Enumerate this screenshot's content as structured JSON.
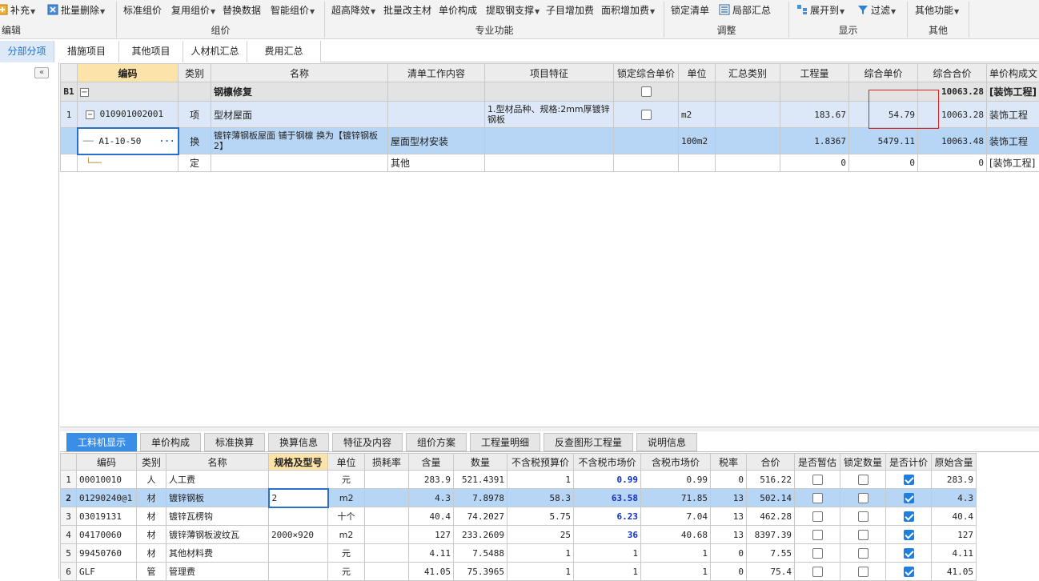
{
  "ribbon": {
    "items": [
      {
        "label": "补充",
        "icon": "add-icon",
        "dropdown": true
      },
      {
        "label": "批量删除",
        "icon": "batch-delete-icon",
        "dropdown": true
      },
      {
        "label": "标准组价",
        "dropdown": false
      },
      {
        "label": "复用组价",
        "dropdown": true
      },
      {
        "label": "替换数据",
        "dropdown": false
      },
      {
        "label": "智能组价",
        "dropdown": true
      },
      {
        "label": "超高降效",
        "dropdown": true
      },
      {
        "label": "批量改主材",
        "dropdown": false
      },
      {
        "label": "单价构成",
        "dropdown": false
      },
      {
        "label": "提取钢支撑",
        "dropdown": true
      },
      {
        "label": "子目增加费",
        "dropdown": false
      },
      {
        "label": "面积增加费",
        "dropdown": true
      },
      {
        "label": "锁定清单",
        "dropdown": false
      },
      {
        "label": "局部汇总",
        "icon": "partial-summary-icon",
        "dropdown": false
      },
      {
        "label": "展开到",
        "icon": "expand-icon",
        "dropdown": true
      },
      {
        "label": "过滤",
        "icon": "filter-icon",
        "dropdown": true
      },
      {
        "label": "其他功能",
        "dropdown": true
      }
    ],
    "groups": [
      "编辑",
      "组价",
      "专业功能",
      "调整",
      "显示",
      "其他"
    ]
  },
  "tabs": [
    "分部分项",
    "措施项目",
    "其他项目",
    "人材机汇总",
    "费用汇总"
  ],
  "top_grid": {
    "headers": [
      "编码",
      "类别",
      "名称",
      "清单工作内容",
      "项目特征",
      "锁定综合单价",
      "单位",
      "汇总类别",
      "工程量",
      "综合单价",
      "综合合价",
      "单价构成文"
    ],
    "row_b1": {
      "num": "B1",
      "name": "钢檩修复",
      "total": "10063.28",
      "composition": "[装饰工程]"
    },
    "row_1": {
      "num": "1",
      "code": "010901002001",
      "type": "项",
      "name": "型材屋面",
      "feature": "1.型材品种、规格:2mm厚镀锌钢板",
      "unit": "m2",
      "qty": "183.67",
      "unit_price": "54.79",
      "total": "10063.28",
      "composition": "装饰工程"
    },
    "row_sub": {
      "code": "A1-10-50",
      "more": "···",
      "type": "换",
      "name": "镀锌薄钢板屋面 铺于钢檩  换为【镀锌钢板2】",
      "work": "屋面型材安装",
      "unit": "100m2",
      "qty": "1.8367",
      "unit_price": "5479.11",
      "total": "10063.48",
      "composition": "装饰工程"
    },
    "row_def": {
      "type": "定",
      "work": "其他",
      "qty": "0",
      "unit_price": "0",
      "total": "0",
      "composition": "[装饰工程]"
    }
  },
  "bottom_tabs": [
    "工料机显示",
    "单价构成",
    "标准换算",
    "换算信息",
    "特征及内容",
    "组价方案",
    "工程量明细",
    "反查图形工程量",
    "说明信息"
  ],
  "bottom_grid": {
    "headers": [
      "编码",
      "类别",
      "名称",
      "规格及型号",
      "单位",
      "损耗率",
      "含量",
      "数量",
      "不含税预算价",
      "不含税市场价",
      "含税市场价",
      "税率",
      "合价",
      "是否暂估",
      "锁定数量",
      "是否计价",
      "原始含量"
    ],
    "rows": [
      {
        "num": "1",
        "code": "00010010",
        "type": "人",
        "name": "人工费",
        "spec": "",
        "unit": "元",
        "loss": "",
        "content": "283.9",
        "qty": "521.4391",
        "pre_budget": "1",
        "pre_market": "0.99",
        "tax_market": "0.99",
        "tax": "0",
        "total": "516.22",
        "est": false,
        "lock": false,
        "priced": true,
        "orig": "283.9"
      },
      {
        "num": "2",
        "code": "01290240@1",
        "type": "材",
        "name": "镀锌钢板",
        "spec": "2",
        "unit": "m2",
        "loss": "",
        "content": "4.3",
        "qty": "7.8978",
        "pre_budget": "58.3",
        "pre_market": "63.58",
        "tax_market": "71.85",
        "tax": "13",
        "total": "502.14",
        "est": false,
        "lock": false,
        "priced": true,
        "orig": "4.3"
      },
      {
        "num": "3",
        "code": "03019131",
        "type": "材",
        "name": "镀锌瓦楞钩",
        "spec": "",
        "unit": "十个",
        "loss": "",
        "content": "40.4",
        "qty": "74.2027",
        "pre_budget": "5.75",
        "pre_market": "6.23",
        "tax_market": "7.04",
        "tax": "13",
        "total": "462.28",
        "est": false,
        "lock": false,
        "priced": true,
        "orig": "40.4"
      },
      {
        "num": "4",
        "code": "04170060",
        "type": "材",
        "name": "镀锌薄钢板波纹瓦",
        "spec": "2000×920",
        "unit": "m2",
        "loss": "",
        "content": "127",
        "qty": "233.2609",
        "pre_budget": "25",
        "pre_market": "36",
        "tax_market": "40.68",
        "tax": "13",
        "total": "8397.39",
        "est": false,
        "lock": false,
        "priced": true,
        "orig": "127"
      },
      {
        "num": "5",
        "code": "99450760",
        "type": "材",
        "name": "其他材料费",
        "spec": "",
        "unit": "元",
        "loss": "",
        "content": "4.11",
        "qty": "7.5488",
        "pre_budget": "1",
        "pre_market": "1",
        "tax_market": "1",
        "tax": "0",
        "total": "7.55",
        "est": false,
        "lock": false,
        "priced": true,
        "orig": "4.11"
      },
      {
        "num": "6",
        "code": "GLF",
        "type": "管",
        "name": "管理费",
        "spec": "",
        "unit": "元",
        "loss": "",
        "content": "41.05",
        "qty": "75.3965",
        "pre_budget": "1",
        "pre_market": "1",
        "tax_market": "1",
        "tax": "0",
        "total": "75.4",
        "est": false,
        "lock": false,
        "priced": true,
        "orig": "41.05"
      }
    ]
  },
  "colors": {
    "accent": "#3a8ee6",
    "selected_row": "#b7d5f4",
    "highlight_box": "#e02020",
    "header_highlight": "#fbe3a9"
  }
}
